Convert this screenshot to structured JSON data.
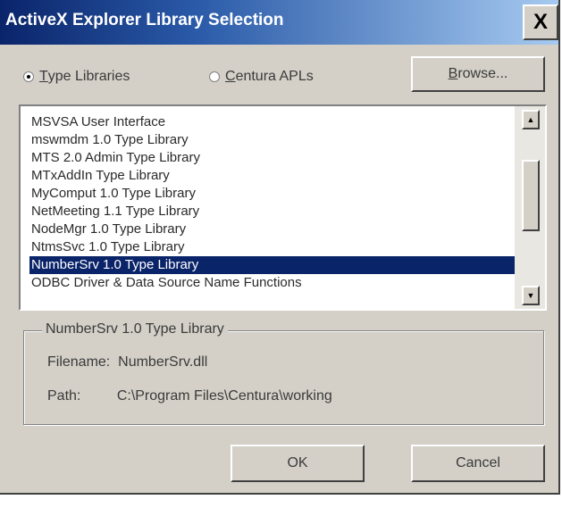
{
  "window": {
    "title": "ActiveX Explorer Library Selection",
    "close_label": "X"
  },
  "source": {
    "type_libraries_label": "Type Libraries",
    "type_libraries_mnemonic": "T",
    "type_libraries_rest": "ype Libraries",
    "type_libraries_checked": true,
    "centura_apls_label": "Centura APLs",
    "centura_apls_mnemonic": "C",
    "centura_apls_rest": "entura APLs",
    "centura_apls_checked": false,
    "browse_label": "Browse...",
    "browse_mnemonic": "B",
    "browse_rest": "rowse..."
  },
  "library_list": {
    "items": [
      "MSVSA User Interface",
      "mswmdm 1.0 Type Library",
      "MTS 2.0 Admin Type Library",
      "MTxAddIn Type Library",
      "MyComput 1.0 Type Library",
      "NetMeeting 1.1 Type Library",
      "NodeMgr 1.0 Type Library",
      "NtmsSvc 1.0 Type Library",
      "NumberSrv 1.0 Type Library",
      "ODBC Driver & Data Source Name Functions"
    ],
    "selected_index": 8
  },
  "details": {
    "group_title": "NumberSrv 1.0 Type Library",
    "filename_label": "Filename:",
    "filename_value": "NumberSrv.dll",
    "path_label": "Path:",
    "path_value": "C:\\Program Files\\Centura\\working"
  },
  "actions": {
    "ok_label": "OK",
    "cancel_label": "Cancel"
  }
}
